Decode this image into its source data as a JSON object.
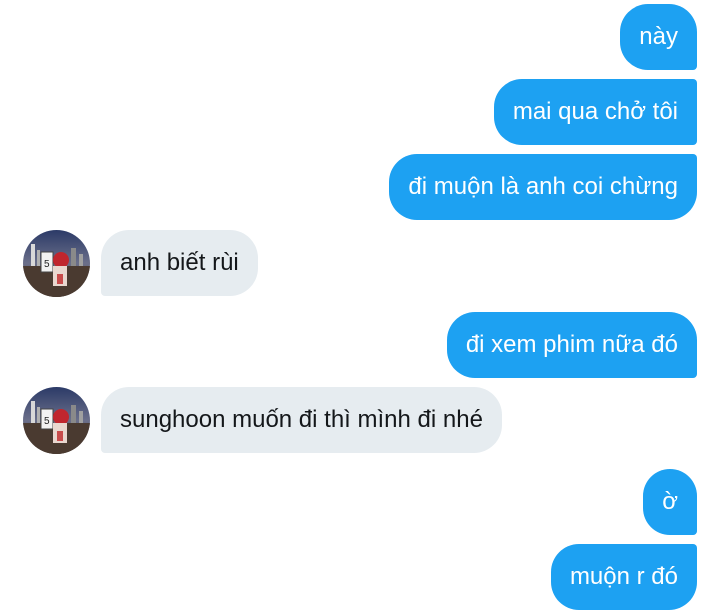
{
  "conversation": {
    "messages": [
      {
        "id": "m1",
        "direction": "sent",
        "text": "này"
      },
      {
        "id": "m2",
        "direction": "sent",
        "text": "mai qua chở tôi"
      },
      {
        "id": "m3",
        "direction": "sent",
        "text": "đi muộn là anh coi chừng"
      },
      {
        "id": "m4",
        "direction": "received",
        "text": "anh biết rùi"
      },
      {
        "id": "m5",
        "direction": "sent",
        "text": "đi xem phim nữa đó"
      },
      {
        "id": "m6",
        "direction": "received",
        "text": "sunghoon muốn đi thì mình đi nhé"
      },
      {
        "id": "m7",
        "direction": "sent",
        "text": "ờ"
      },
      {
        "id": "m8",
        "direction": "sent",
        "text": "muộn r đó"
      }
    ]
  },
  "colors": {
    "sent_bubble": "#1da1f2",
    "received_bubble": "#e6ecf0",
    "sent_text": "#ffffff",
    "received_text": "#14171a"
  },
  "icons": {
    "contact_avatar": "avatar-photo-icon"
  }
}
